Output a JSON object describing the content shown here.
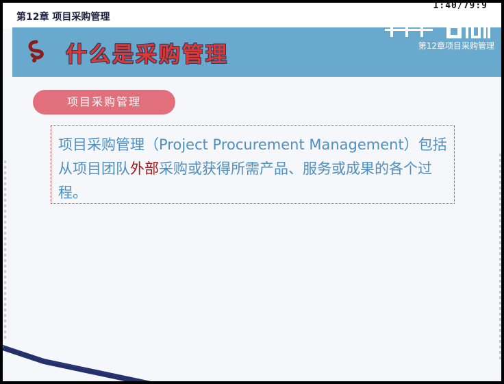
{
  "header": {
    "chapter_label": "第12章 项目采购管理",
    "timer": "1:40/79:9"
  },
  "banner": {
    "title": "什么是采购管理",
    "chapter_label": "第12章项目采购管理",
    "logo_icon": "brand-logo"
  },
  "section": {
    "pill_label": "项目采购管理"
  },
  "definition": {
    "part1": "项目采购管理（Project Procurement Management）包括从项目团队",
    "highlight": "外部",
    "part2": "采购或获得所需产品、服务或成果的各个过程。"
  },
  "colors": {
    "banner_bg": "#6aa9ce",
    "title_red": "#d83a3a",
    "pill_bg": "#e2707c",
    "body_text": "#4d8fc0",
    "highlight": "#a01818"
  }
}
